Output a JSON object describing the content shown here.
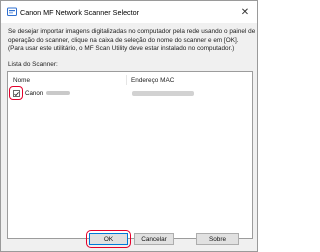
{
  "window": {
    "title": "Canon MF Network Scanner Selector",
    "close_glyph": "✕"
  },
  "description": {
    "line1": "Se desejar importar imagens digitalizadas no computador pela rede usando o painel de",
    "line2": "operação do scanner, clique na caixa de seleção do nome do scanner e em [OK].",
    "line3": "(Para usar este utilitário, o MF Scan Utility deve estar instalado no computador.)"
  },
  "scanner_list": {
    "label": "Lista do Scanner:",
    "columns": {
      "name": "Nome",
      "mac": "Endereço MAC"
    },
    "rows": [
      {
        "name": "Canon",
        "checked": true
      }
    ]
  },
  "buttons": {
    "ok": "OK",
    "cancel": "Cancelar",
    "about": "Sobre"
  },
  "colors": {
    "highlight": "#e4002b",
    "ok_border": "#0078d7",
    "icon_blue": "#2f6fcf"
  },
  "icons": {
    "app": "scanner-app-icon",
    "close": "close-icon",
    "check": "check-icon"
  }
}
